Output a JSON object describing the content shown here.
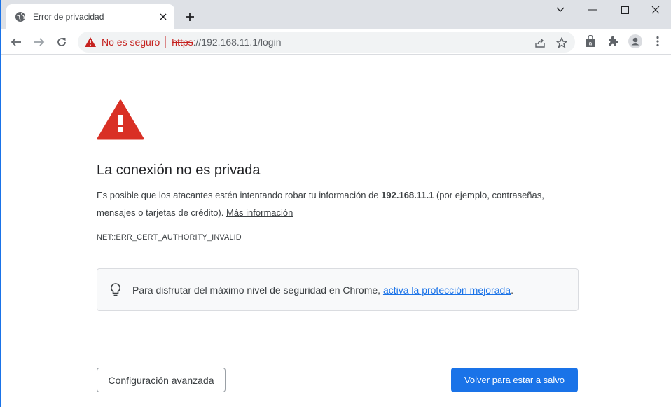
{
  "browser": {
    "tab": {
      "title": "Error de privacidad"
    },
    "omnibox": {
      "security_label": "No es seguro",
      "url_scheme": "https",
      "url_rest": "://192.168.11.1/login"
    }
  },
  "interstitial": {
    "heading": "La conexión no es privada",
    "para_prefix": "Es posible que los atacantes estén intentando robar tu información de ",
    "host": "192.168.11.1",
    "para_suffix": " (por ejemplo, contraseñas, mensajes o tarjetas de crédito). ",
    "more_info": "Más información",
    "error_code": "NET::ERR_CERT_AUTHORITY_INVALID",
    "tip_text": "Para disfrutar del máximo nivel de seguridad en Chrome, ",
    "tip_link": "activa la protección mejorada",
    "tip_end": ".",
    "advanced_button": "Configuración avanzada",
    "back_button": "Volver para estar a salvo"
  },
  "colors": {
    "warning_red": "#d93025",
    "link_blue": "#1a73e8",
    "primary_button": "#1a73e8"
  },
  "icons": [
    "globe-icon",
    "close-icon",
    "plus-icon",
    "chevron-down-icon",
    "minimize-icon",
    "maximize-icon",
    "window-close-icon",
    "back-arrow-icon",
    "forward-arrow-icon",
    "reload-icon",
    "warning-triangle-icon",
    "share-icon",
    "star-icon",
    "shopping-bag-icon",
    "puzzle-icon",
    "profile-icon",
    "kebab-menu-icon",
    "lightbulb-icon"
  ]
}
